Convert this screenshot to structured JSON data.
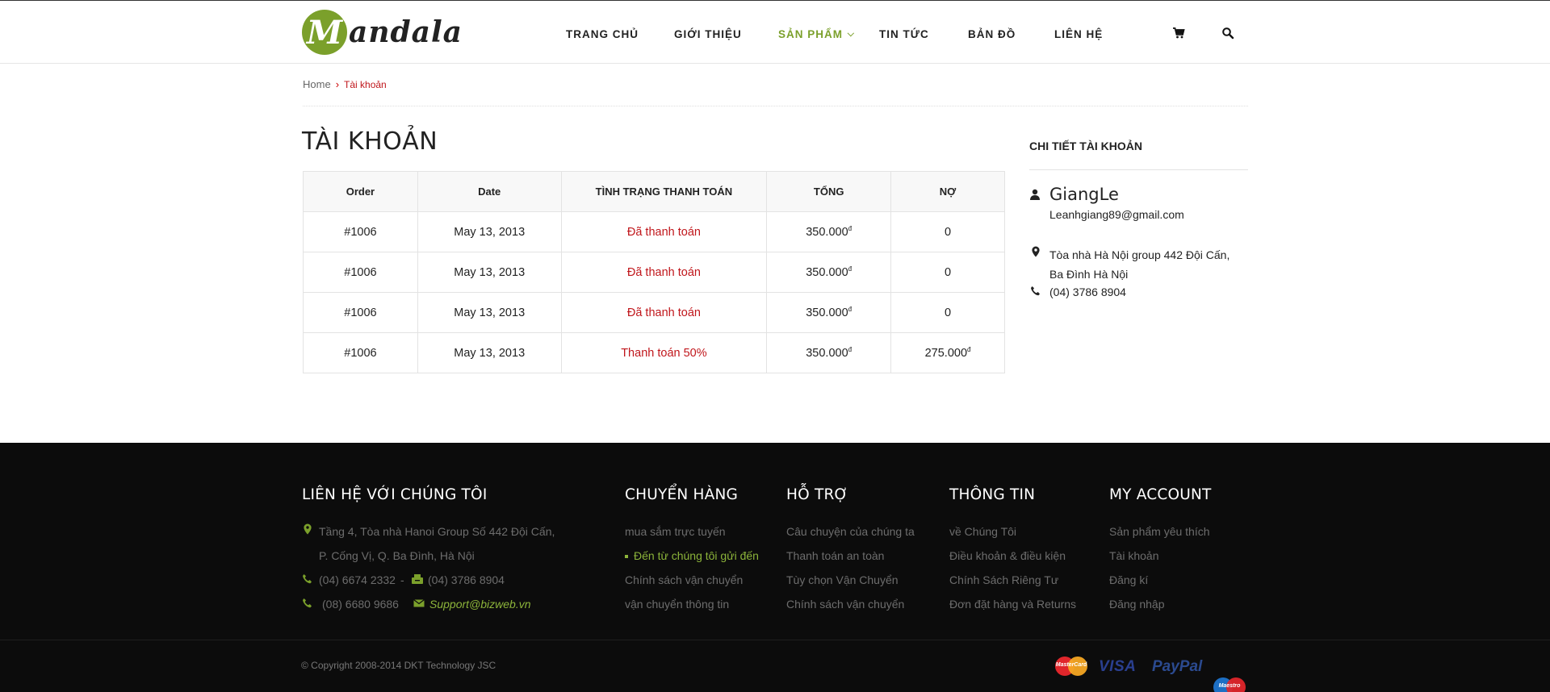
{
  "brand": {
    "logo_letter": "M",
    "logo_text": "andala",
    "accent_color": "#7ba02b",
    "alert_color": "#c0161b"
  },
  "nav": {
    "items": [
      {
        "label": "TRANG CHỦ"
      },
      {
        "label": "GIỚI THIỆU"
      },
      {
        "label": "SẢN PHẨM",
        "active": true,
        "dropdown": true
      },
      {
        "label": "TIN TỨC"
      },
      {
        "label": "BẢN ĐỒ"
      },
      {
        "label": "LIÊN HỆ"
      }
    ],
    "icons": [
      "cart-icon",
      "search-icon"
    ]
  },
  "breadcrumb": {
    "home": "Home",
    "current": "Tài khoản"
  },
  "page": {
    "title": "TÀI KHOẢN"
  },
  "orders": {
    "headers": [
      "Order",
      "Date",
      "TÌNH TRẠNG THANH TOÁN",
      "TỔNG",
      "NỢ"
    ],
    "currency_symbol": "đ",
    "rows": [
      {
        "order": "#1006",
        "date": "May 13, 2013",
        "status": "Đã thanh toán",
        "total": "350.000",
        "debt": "0"
      },
      {
        "order": "#1006",
        "date": "May 13, 2013",
        "status": "Đã thanh toán",
        "total": "350.000",
        "debt": "0"
      },
      {
        "order": "#1006",
        "date": "May 13, 2013",
        "status": "Đã thanh toán",
        "total": "350.000",
        "debt": "0"
      },
      {
        "order": "#1006",
        "date": "May 13, 2013",
        "status": "Thanh toán 50%",
        "total": "350.000",
        "debt": "275.000"
      }
    ]
  },
  "account": {
    "title": "CHI TIẾT TÀI KHOẢN",
    "name": "GiangLe",
    "email": "Leanhgiang89@gmail.com",
    "address": "Tòa nhà Hà Nội group 442 Đội Cấn, Ba Đình Hà Nội",
    "phone": "(04) 3786 8904"
  },
  "footer": {
    "contact": {
      "title": "LIÊN HỆ VỚI CHÚNG TÔI",
      "address_line1": "Tầng 4, Tòa nhà Hanoi Group  Số 442 Đội Cấn,",
      "address_line2": "P. Cống Vị, Q. Ba Đình, Hà Nội",
      "phone1": "(04) 6674 2332",
      "separator": "-",
      "phone2": "(04) 3786 8904",
      "phone3": "(08) 6680 9686",
      "email": "Support@bizweb.vn"
    },
    "shipping": {
      "title": "CHUYỂN HÀNG",
      "links": [
        "mua sắm trực tuyến",
        "Đến từ chúng tôi gửi đến",
        "Chính sách vận chuyển",
        "vận chuyển thông tin"
      ]
    },
    "support": {
      "title": "HỖ TRỢ",
      "links": [
        "Câu chuyện của chúng ta",
        "Thanh toán an toàn",
        "Tùy chọn Vận Chuyển",
        "Chính sách vận chuyển"
      ]
    },
    "info": {
      "title": "THÔNG TIN",
      "links": [
        "về Chúng Tôi",
        "Điều khoản & điều kiện",
        "Chính Sách Riêng Tư",
        "Đơn đặt hàng và Returns"
      ]
    },
    "account": {
      "title": "MY ACCOUNT",
      "links": [
        "Sản phẩm yêu thích",
        "Tài khoản",
        "Đăng kí",
        "Đăng nhập"
      ]
    },
    "copyright": "© Copyright 2008-2014 DKT Technology JSC",
    "payments": {
      "mastercard": "MasterCard",
      "visa": "VISA",
      "paypal": "PayPal",
      "maestro": "Maestro"
    }
  }
}
